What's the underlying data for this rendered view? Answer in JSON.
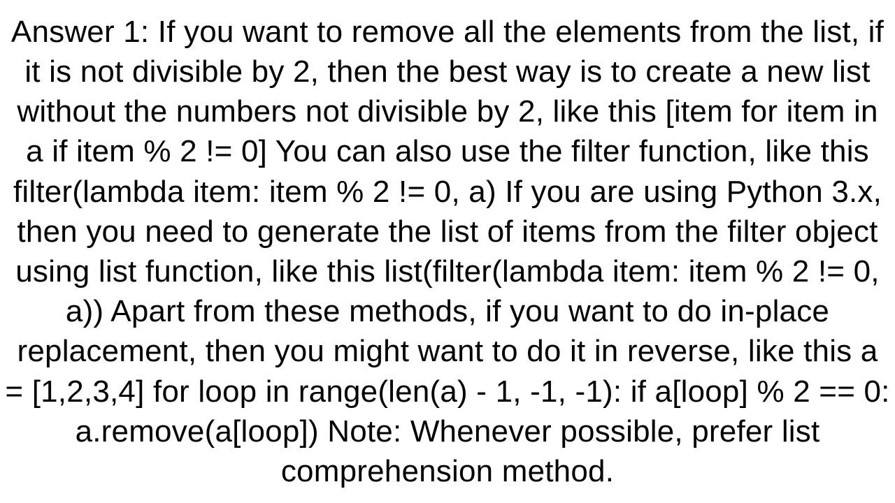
{
  "answer": {
    "body": "Answer 1: If you want to remove all the elements from the list, if it is not divisible by 2, then the best way is to create a new list without the numbers not divisible by 2, like this [item for item in a if item % 2 != 0]  You can also use the filter function, like this filter(lambda item: item % 2 != 0, a)  If you are using Python 3.x, then you need to generate the list of items from the filter object using list function, like this list(filter(lambda item: item % 2 != 0, a))  Apart from these methods, if you want to do in-place replacement, then you might want to do it in reverse, like this a = [1,2,3,4] for loop in range(len(a) - 1, -1, -1):     if a[loop] % 2 == 0:         a.remove(a[loop])  Note: Whenever possible, prefer list comprehension method."
  }
}
